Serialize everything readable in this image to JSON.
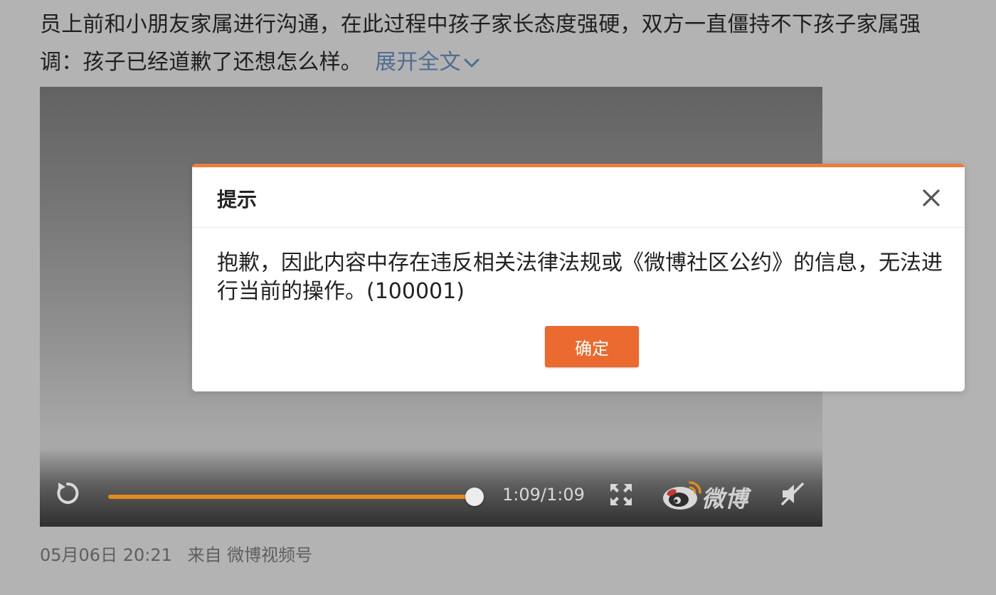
{
  "post": {
    "line1": "员上前和小朋友家属进行沟通，在此过程中孩子家长态度强硬，双方一直僵持不下孩子家属强",
    "line2": "调：孩子已经道歉了还想怎么样。",
    "expand_label": "展开全文"
  },
  "video": {
    "time": "1:09/1:09",
    "progress": 1.0,
    "brand": "微博",
    "colors": {
      "progress": "#e08a21"
    }
  },
  "meta": {
    "date": "05月06日 20:21",
    "source": "来自 微博视频号"
  },
  "dialog": {
    "title": "提示",
    "message": "抱歉，因此内容中存在违反相关法律法规或《微博社区公约》的信息，无法进行当前的操作。(100001)",
    "confirm_label": "确定",
    "colors": {
      "accent": "#ee7c3c",
      "button": "#ea6a2f"
    }
  }
}
